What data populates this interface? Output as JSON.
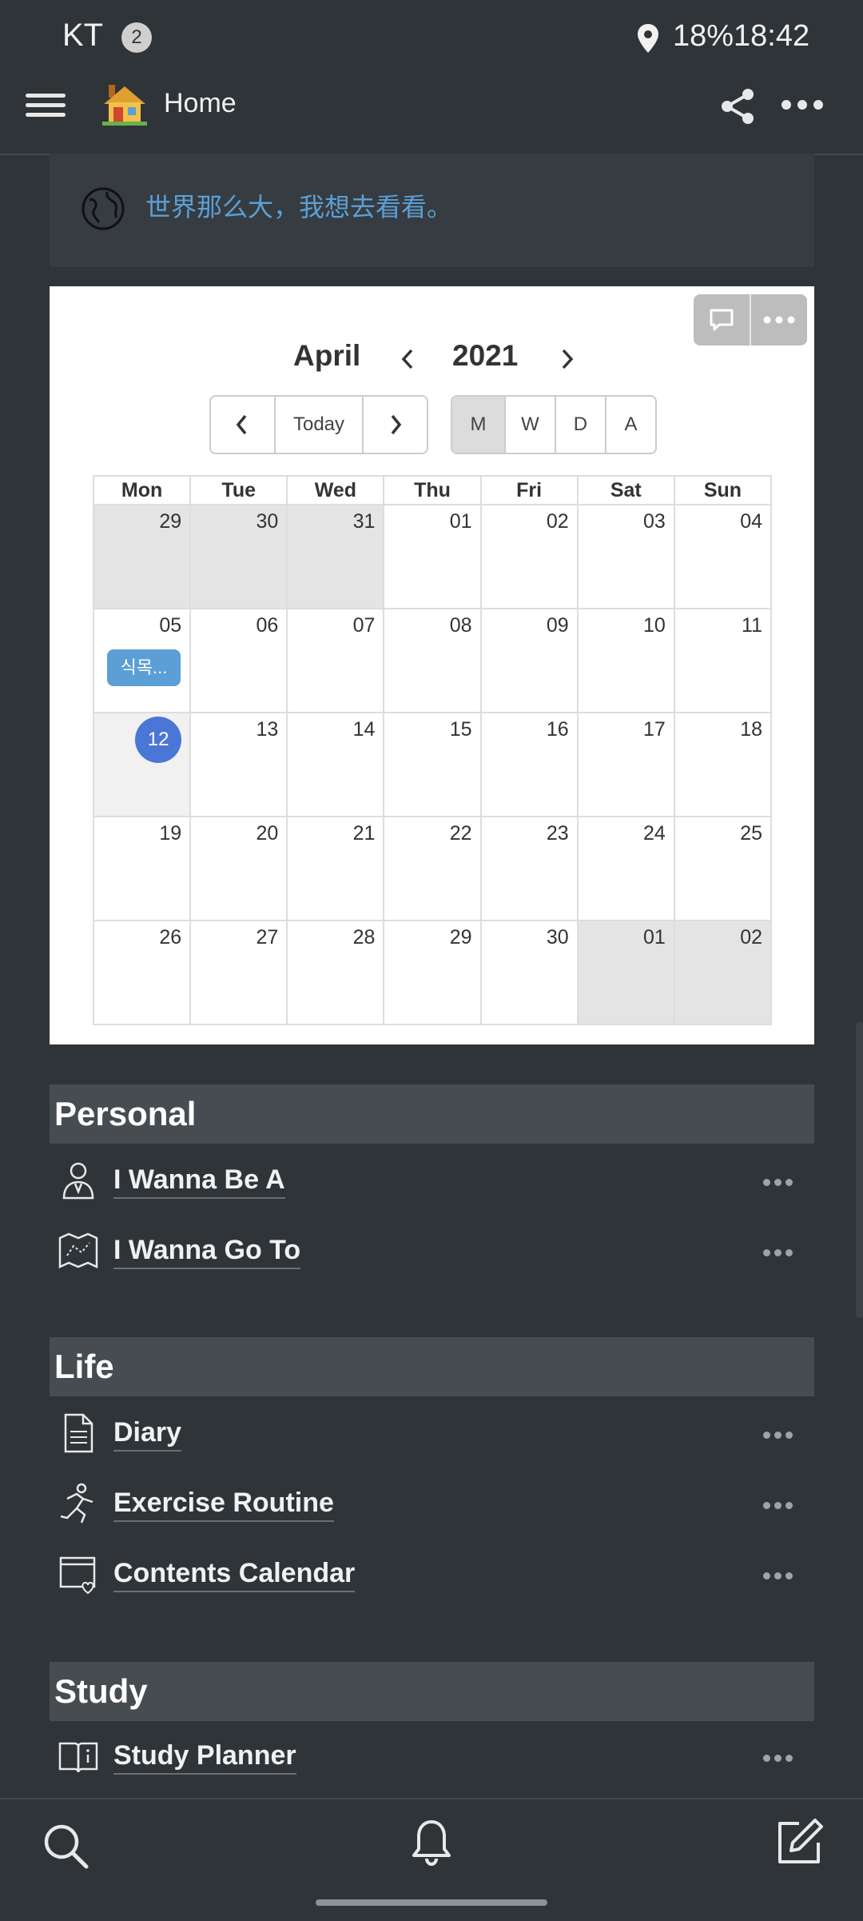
{
  "status_bar": {
    "carrier": "KT",
    "notification_count": "2",
    "battery": "18%",
    "time": "18:42",
    "icons": [
      "location-icon"
    ]
  },
  "header": {
    "title": "Home",
    "icons": [
      "hamburger-icon",
      "house-icon",
      "share-icon",
      "more-icon"
    ]
  },
  "quote": {
    "text": "世界那么大，我想去看看。",
    "icon": "globe-icon",
    "text_color": "#5b9fd6"
  },
  "calendar": {
    "month": "April",
    "year": "2021",
    "nav_buttons": {
      "prev": "‹",
      "today": "Today",
      "next": "›"
    },
    "view_buttons": [
      "M",
      "W",
      "D",
      "A"
    ],
    "active_view": "M",
    "weekdays": [
      "Mon",
      "Tue",
      "Wed",
      "Thu",
      "Fri",
      "Sat",
      "Sun"
    ],
    "weeks": [
      [
        "29",
        "30",
        "31",
        "01",
        "02",
        "03",
        "04"
      ],
      [
        "05",
        "06",
        "07",
        "08",
        "09",
        "10",
        "11"
      ],
      [
        "12",
        "13",
        "14",
        "15",
        "16",
        "17",
        "18"
      ],
      [
        "19",
        "20",
        "21",
        "22",
        "23",
        "24",
        "25"
      ],
      [
        "26",
        "27",
        "28",
        "29",
        "30",
        "01",
        "02"
      ]
    ],
    "today": "12",
    "event": {
      "day": "05",
      "label": "식목..."
    },
    "accent_color": "#4a77d6"
  },
  "sections": [
    {
      "title": "Personal",
      "items": [
        {
          "label": "I Wanna Be A",
          "icon": "person-icon"
        },
        {
          "label": "I Wanna Go To",
          "icon": "map-icon"
        }
      ]
    },
    {
      "title": "Life",
      "items": [
        {
          "label": "Diary",
          "icon": "document-icon"
        },
        {
          "label": "Exercise Routine",
          "icon": "runner-icon"
        },
        {
          "label": "Contents Calendar",
          "icon": "calendar-heart-icon"
        }
      ]
    },
    {
      "title": "Study",
      "items": [
        {
          "label": "Study Planner",
          "icon": "book-info-icon"
        }
      ]
    }
  ],
  "bottom_bar": {
    "icons": [
      "search-icon",
      "bell-icon",
      "compose-icon"
    ]
  }
}
